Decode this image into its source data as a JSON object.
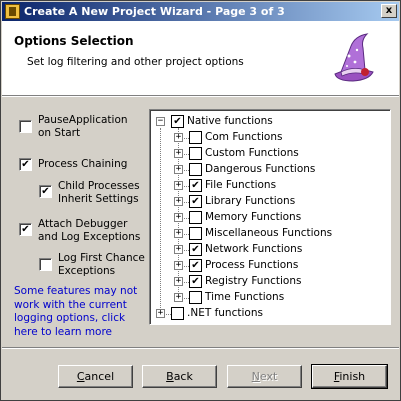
{
  "window": {
    "title": "Create A New Project Wizard - Page 3 of 3",
    "close_glyph": "x"
  },
  "header": {
    "title": "Options Selection",
    "subtitle": "Set log filtering and other project options",
    "image_icon": "wizard-hat-icon"
  },
  "options": {
    "pause_application": {
      "label_line1": "PauseApplication",
      "label_line2": "on Start",
      "checked": false
    },
    "process_chaining": {
      "label": "Process Chaining",
      "checked": true
    },
    "child_processes": {
      "label_line1": "Child Processes",
      "label_line2": "Inherit Settings",
      "checked": true
    },
    "attach_debugger": {
      "label_line1": "Attach Debugger",
      "label_line2": "and Log Exceptions",
      "checked": true
    },
    "log_first_chance": {
      "label_line1": "Log First Chance",
      "label_line2": "Exceptions",
      "checked": false
    }
  },
  "info_link": {
    "line1": "Some features may not",
    "line2": "work with the current",
    "line3": "logging options, click",
    "line4": "here to learn more"
  },
  "tree": {
    "root": {
      "label": "Native functions",
      "checked": true,
      "expander": "−"
    },
    "children": [
      {
        "label": "Com Functions",
        "checked": false,
        "expander": "+"
      },
      {
        "label": "Custom Functions",
        "checked": false,
        "expander": "+"
      },
      {
        "label": "Dangerous Functions",
        "checked": false,
        "expander": "+"
      },
      {
        "label": "File Functions",
        "checked": true,
        "expander": "+"
      },
      {
        "label": "Library Functions",
        "checked": true,
        "expander": "+"
      },
      {
        "label": "Memory Functions",
        "checked": false,
        "expander": "+"
      },
      {
        "label": "Miscellaneous Functions",
        "checked": false,
        "expander": "+"
      },
      {
        "label": "Network Functions",
        "checked": true,
        "expander": "+"
      },
      {
        "label": "Process Functions",
        "checked": true,
        "expander": "+"
      },
      {
        "label": "Registry Functions",
        "checked": true,
        "expander": "+"
      },
      {
        "label": "Time Functions",
        "checked": false,
        "expander": "+"
      }
    ],
    "net": {
      "label": ".NET functions",
      "checked": false,
      "expander": "+"
    }
  },
  "buttons": {
    "cancel": "Cancel",
    "back": "Back",
    "next": "Next",
    "finish": "Finish"
  },
  "colors": {
    "title_start": "#0a246a",
    "title_end": "#a6caf0",
    "link": "#0000cc",
    "face": "#d4d0c8"
  }
}
